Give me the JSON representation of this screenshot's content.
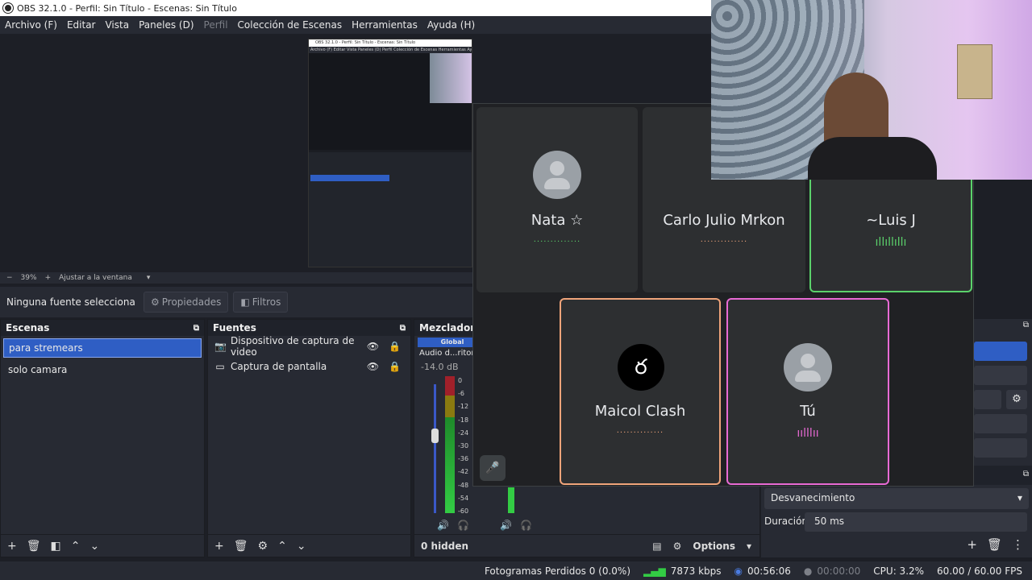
{
  "window": {
    "title": "OBS 32.1.0 - Perfil: Sin Título - Escenas: Sin Título"
  },
  "menu": [
    "Archivo (F)",
    "Editar",
    "Vista",
    "Paneles (D)",
    "Perfil",
    "Colección de Escenas",
    "Herramientas",
    "Ayuda (H)"
  ],
  "zoom": {
    "minus": "−",
    "value": "39%",
    "plus": "+",
    "fit": "Ajustar a la ventana"
  },
  "source_bar": {
    "label": "Ninguna fuente selecciona",
    "properties": "Propiedades",
    "filters": "Filtros"
  },
  "scenes": {
    "title": "Escenas",
    "items": [
      "para stremears",
      "solo camara"
    ],
    "selected": "para stremears"
  },
  "sources": {
    "title": "Fuentes",
    "items": [
      "Dispositivo de captura de video",
      "Captura de pantalla"
    ]
  },
  "mixer": {
    "title": "Mezclador d",
    "tab": "Global",
    "channel": "Audio d...ritorio",
    "db": "-14.0 dB",
    "scale": [
      "0",
      "-6",
      "-12",
      "-18",
      "-24",
      "-30",
      "-36",
      "-42",
      "-48",
      "-54",
      "-60"
    ],
    "hidden": "0 hidden",
    "options": "Options"
  },
  "transitions": {
    "type": "Desvanecimiento",
    "duration_label": "Duración",
    "duration_value": "50 ms"
  },
  "meet": {
    "participants": [
      {
        "name": "Nata ☆"
      },
      {
        "name": "Carlo Julio Mrkon"
      },
      {
        "name": "~Luis J"
      },
      {
        "name": "Maicol Clash"
      },
      {
        "name": "Tú"
      }
    ],
    "colors": {
      "speaking": "#5bd26b",
      "maicol_border": "#f0a47a",
      "you_border": "#e86ad4"
    }
  },
  "status": {
    "dropped": "Fotogramas Perdidos 0 (0.0%)",
    "bitrate": "7873 kbps",
    "stream_time": "00:56:06",
    "rec_time": "00:00:00",
    "cpu": "CPU: 3.2%",
    "fps": "60.00 / 60.00 FPS"
  },
  "nested": {
    "title": "OBS 32.1.0 - Perfil: Sin Título - Escenas: Sin Título",
    "menu": "Archivo (F)   Editar   Vista   Paneles (D)   Perfil   Colección de Escenas   Herramientas   Ayuda (H)"
  }
}
